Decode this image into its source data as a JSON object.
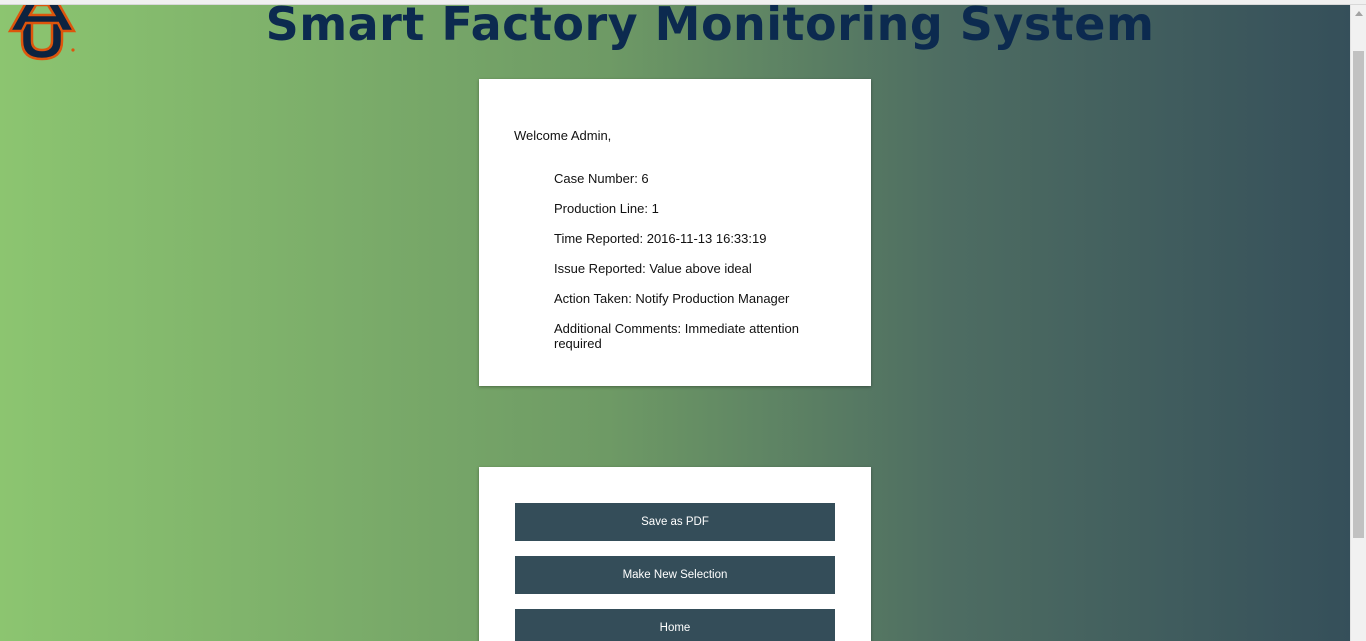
{
  "header": {
    "title": "Smart Factory Monitoring System",
    "logo_icon": "au-logo-icon",
    "logo_colors": {
      "navy": "#0c2340",
      "orange": "#dd550c"
    }
  },
  "report": {
    "welcome": "Welcome Admin,",
    "case_number": "Case Number: 6",
    "production_line": "Production Line: 1",
    "time_reported": "Time Reported: 2016-11-13 16:33:19",
    "issue_reported": "Issue Reported: Value above ideal",
    "action_taken": "Action Taken: Notify Production Manager",
    "additional_comments": "Additional Comments: Immediate attention required"
  },
  "actions": {
    "save_pdf": "Save as PDF",
    "new_selection": "Make New Selection",
    "home": "Home"
  },
  "colors": {
    "gradient_left": "#8cc570",
    "gradient_right": "#354f5a",
    "title_color": "#0c2a4f",
    "button_bg": "#344d59",
    "button_text": "#ffffff"
  }
}
